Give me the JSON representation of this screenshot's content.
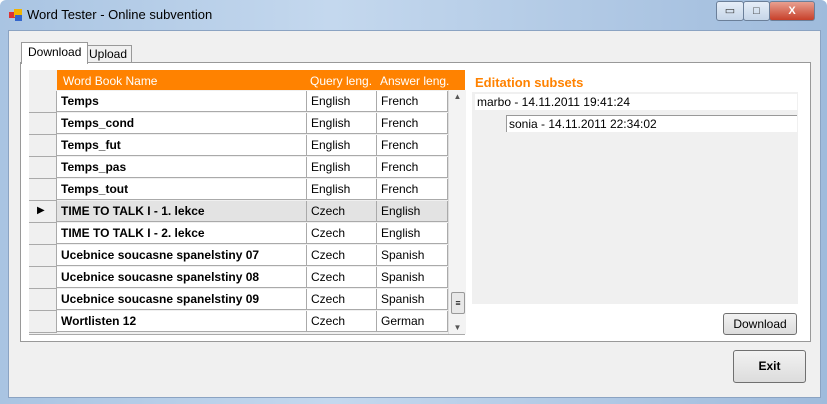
{
  "window": {
    "title": "Word Tester - Online subvention",
    "minimize": "▭",
    "maximize": "□",
    "close": "X"
  },
  "tabs": [
    {
      "label": "Download"
    },
    {
      "label": "Upload"
    }
  ],
  "grid": {
    "columns": [
      "Word Book Name",
      "Query leng.",
      "Answer leng."
    ],
    "rows": [
      {
        "name": "Temps",
        "query": "English",
        "answer": "French"
      },
      {
        "name": "Temps_cond",
        "query": "English",
        "answer": "French"
      },
      {
        "name": "Temps_fut",
        "query": "English",
        "answer": "French"
      },
      {
        "name": "Temps_pas",
        "query": "English",
        "answer": "French"
      },
      {
        "name": "Temps_tout",
        "query": "English",
        "answer": "French"
      },
      {
        "name": "TIME TO TALK I - 1. lekce",
        "query": "Czech",
        "answer": "English"
      },
      {
        "name": "TIME TO TALK I - 2. lekce",
        "query": "Czech",
        "answer": "English"
      },
      {
        "name": "Ucebnice soucasne spanelstiny 07",
        "query": "Czech",
        "answer": "Spanish"
      },
      {
        "name": "Ucebnice soucasne spanelstiny 08",
        "query": "Czech",
        "answer": "Spanish"
      },
      {
        "name": "Ucebnice soucasne spanelstiny 09",
        "query": "Czech",
        "answer": "Spanish"
      },
      {
        "name": "Wortlisten 12",
        "query": "Czech",
        "answer": "German"
      }
    ]
  },
  "subsets": {
    "title": "Editation subsets",
    "items": [
      "marbo - 14.11.2011 19:41:24",
      "sonia - 14.11.2011 22:34:02"
    ]
  },
  "buttons": {
    "download": "Download",
    "exit": "Exit"
  },
  "colors": {
    "accent": "#ff8200"
  }
}
